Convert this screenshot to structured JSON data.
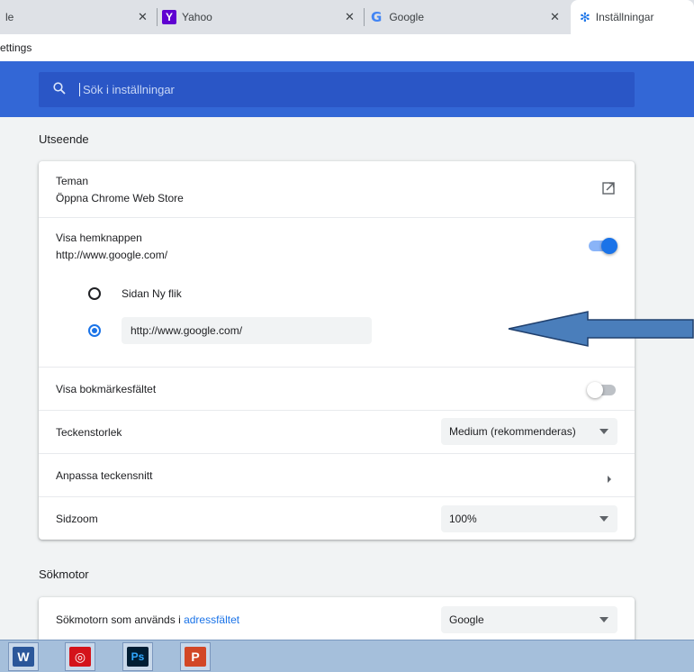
{
  "tabs": [
    {
      "label": "le",
      "state": "inactive"
    },
    {
      "label": "Yahoo",
      "icon": "yahoo-icon"
    },
    {
      "label": "Google",
      "icon": "google-icon"
    },
    {
      "label": "Inställningar",
      "icon": "gear-icon",
      "state": "active"
    }
  ],
  "close_glyph": "✕",
  "address": {
    "text": "ettings"
  },
  "search": {
    "placeholder": "Sök i inställningar",
    "icon": "search-icon"
  },
  "appearance": {
    "title": "Utseende",
    "themes": {
      "label": "Teman",
      "sublabel": "Öppna Chrome Web Store",
      "icon": "external-link-icon"
    },
    "home_button": {
      "label": "Visa hemknappen",
      "sublabel": "http://www.google.com/",
      "enabled": true,
      "options": [
        {
          "label": "Sidan Ny flik",
          "selected": false
        },
        {
          "label": "http://www.google.com/",
          "selected": true
        }
      ]
    },
    "bookmarks_bar": {
      "label": "Visa bokmärkesfältet",
      "enabled": false
    },
    "font_size": {
      "label": "Teckenstorlek",
      "value": "Medium (rekommenderas)"
    },
    "customize_fonts": {
      "label": "Anpassa teckensnitt"
    },
    "page_zoom": {
      "label": "Sidzoom",
      "value": "100%"
    }
  },
  "search_engine": {
    "title": "Sökmotor",
    "label_prefix": "Sökmotorn som används i ",
    "label_link": "adressfältet",
    "value": "Google"
  },
  "taskbar": [
    {
      "icon": "word-icon",
      "glyph": "W",
      "color": "#2b579a"
    },
    {
      "icon": "acrobat-icon",
      "glyph": "◎",
      "color": "#d4131a"
    },
    {
      "icon": "photoshop-icon",
      "glyph": "Ps",
      "color": "#001d34"
    },
    {
      "icon": "powerpoint-icon",
      "glyph": "P",
      "color": "#d24726"
    }
  ],
  "colors": {
    "accent": "#1a73e8",
    "header": "#3367d6",
    "arrow": "#4a7ebb"
  }
}
